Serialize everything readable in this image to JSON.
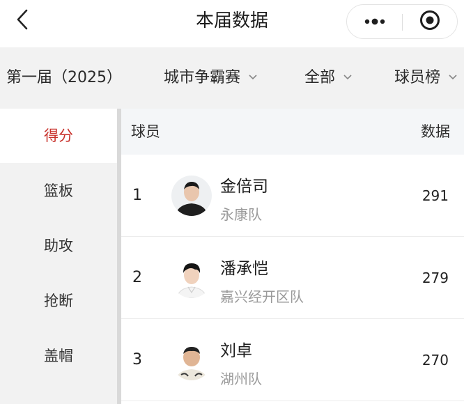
{
  "header": {
    "title": "本届数据",
    "back_icon": "chevron-left-icon",
    "more_icon": "more-dots-icon",
    "close_icon": "target-circle-icon"
  },
  "filters": {
    "season": "第一届（2025）",
    "competition": "城市争霸赛",
    "scope": "全部",
    "board": "球员榜"
  },
  "sidebar": {
    "items": [
      {
        "label": "得分",
        "active": true
      },
      {
        "label": "篮板",
        "active": false
      },
      {
        "label": "助攻",
        "active": false
      },
      {
        "label": "抢断",
        "active": false
      },
      {
        "label": "盖帽",
        "active": false
      }
    ]
  },
  "table": {
    "col_player": "球员",
    "col_data": "数据",
    "rows": [
      {
        "rank": "1",
        "name": "金倍司",
        "team": "永康队",
        "value": "291"
      },
      {
        "rank": "2",
        "name": "潘承恺",
        "team": "嘉兴经开区队",
        "value": "279"
      },
      {
        "rank": "3",
        "name": "刘卓",
        "team": "湖州队",
        "value": "270"
      }
    ]
  },
  "colors": {
    "accent": "#c8312b",
    "sidebar_bg": "#f2f2f2",
    "header_row_bg": "#f4f6f8",
    "muted_text": "#9a9a9a"
  }
}
